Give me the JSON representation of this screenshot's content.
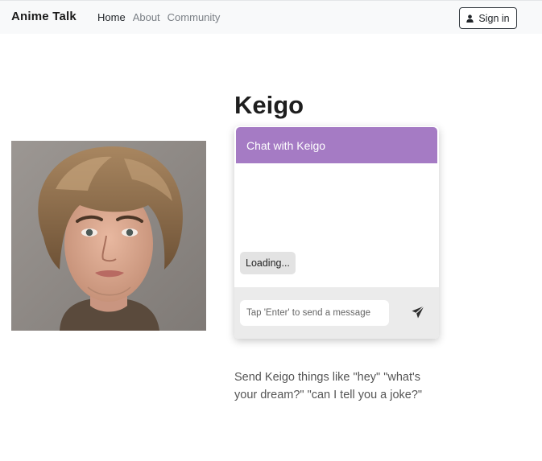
{
  "navbar": {
    "brand": "Anime Talk",
    "links": [
      {
        "label": "Home",
        "active": true
      },
      {
        "label": "About",
        "active": false
      },
      {
        "label": "Community",
        "active": false
      }
    ],
    "signin_label": "Sign in",
    "signin_icon": "person-icon"
  },
  "character": {
    "name": "Keigo"
  },
  "chat": {
    "header_title": "Chat with Keigo",
    "messages": [
      {
        "text": "Loading..."
      }
    ],
    "input_placeholder": "Tap 'Enter' to send a message",
    "send_icon": "paper-plane-icon"
  },
  "hint_text": "Send Keigo things like \"hey\" \"what's your dream?\" \"can I tell you a joke?\"",
  "colors": {
    "chat_header": "#a57bc4",
    "navbar_bg": "#f8f9fa",
    "chat_footer_bg": "#ebebeb"
  }
}
